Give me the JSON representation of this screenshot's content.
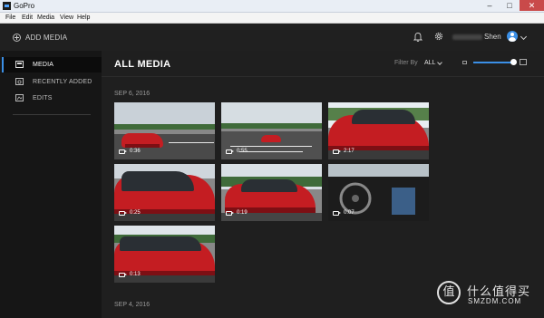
{
  "window": {
    "title": "GoPro",
    "controls": [
      "–",
      "□",
      "✕"
    ]
  },
  "menu": [
    "File",
    "Edit",
    "Media",
    "View",
    "Help"
  ],
  "header": {
    "add_media_label": "ADD MEDIA",
    "user_name": "Shen",
    "icons": [
      "plus-circle-icon",
      "bell-icon",
      "gear-icon",
      "avatar-icon",
      "chevron-down-icon"
    ]
  },
  "sidebar": {
    "items": [
      {
        "label": "MEDIA",
        "icon": "media-icon",
        "active": true
      },
      {
        "label": "RECENTLY ADDED",
        "icon": "recently-added-icon",
        "active": false
      },
      {
        "label": "EDITS",
        "icon": "edits-icon",
        "active": false
      }
    ]
  },
  "main": {
    "title": "ALL MEDIA",
    "filter_label": "Filter By",
    "filter_value": "ALL",
    "groups": [
      {
        "date": "SEP 6, 2016",
        "items": [
          {
            "duration": "0:36",
            "scene": "parking-lot-front"
          },
          {
            "duration": "0:55",
            "scene": "parking-lot-wide"
          },
          {
            "duration": "2:17",
            "scene": "car-side-closeup"
          },
          {
            "duration": "0:25",
            "scene": "car-side-reflection"
          },
          {
            "duration": "0:19",
            "scene": "car-side-low"
          },
          {
            "duration": "0:07",
            "scene": "car-interior"
          },
          {
            "duration": "0:13",
            "scene": "car-door-closeup"
          }
        ]
      },
      {
        "date": "SEP 4, 2016",
        "items": []
      }
    ]
  },
  "watermark": {
    "cn": "什么值得买",
    "en": "SMZDM.COM",
    "logo_char": "值"
  },
  "colors": {
    "accent": "#3b8fe6",
    "car_red": "#c41d22",
    "background": "#1f1f1f"
  }
}
